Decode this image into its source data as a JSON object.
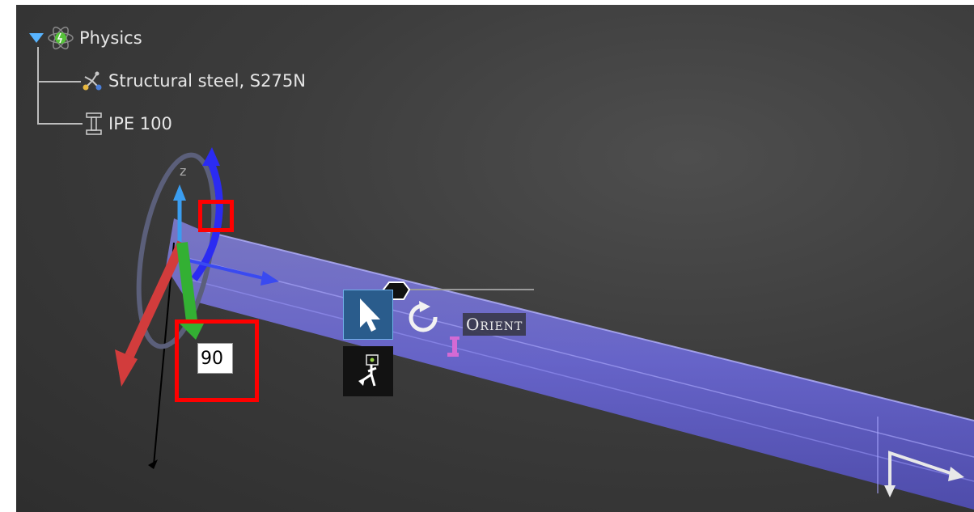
{
  "tree": {
    "root_label": "Physics",
    "children": [
      {
        "label": "Structural steel, S275N",
        "icon": "material-molecule-icon"
      },
      {
        "label": "IPE 100",
        "icon": "i-beam-icon"
      }
    ],
    "root_icon": "physics-atom-icon",
    "expand_icon": "expand-triangle-icon"
  },
  "gizmo": {
    "axis_z_label": "z",
    "rotation_angle_value": "90"
  },
  "toolbar": {
    "orient_label": "Orient",
    "select_icon": "cursor-arrow-icon",
    "move_icon": "move-icon",
    "rotate_icon": "rotate-icon"
  },
  "colors": {
    "background": "#3a3a3a",
    "beam": "#7b78e8",
    "axis_x": "#d23c3c",
    "axis_y": "#3cb43c",
    "axis_z": "#2a2af0",
    "highlight": "#ff0000",
    "select_active": "#2a5c8c"
  }
}
